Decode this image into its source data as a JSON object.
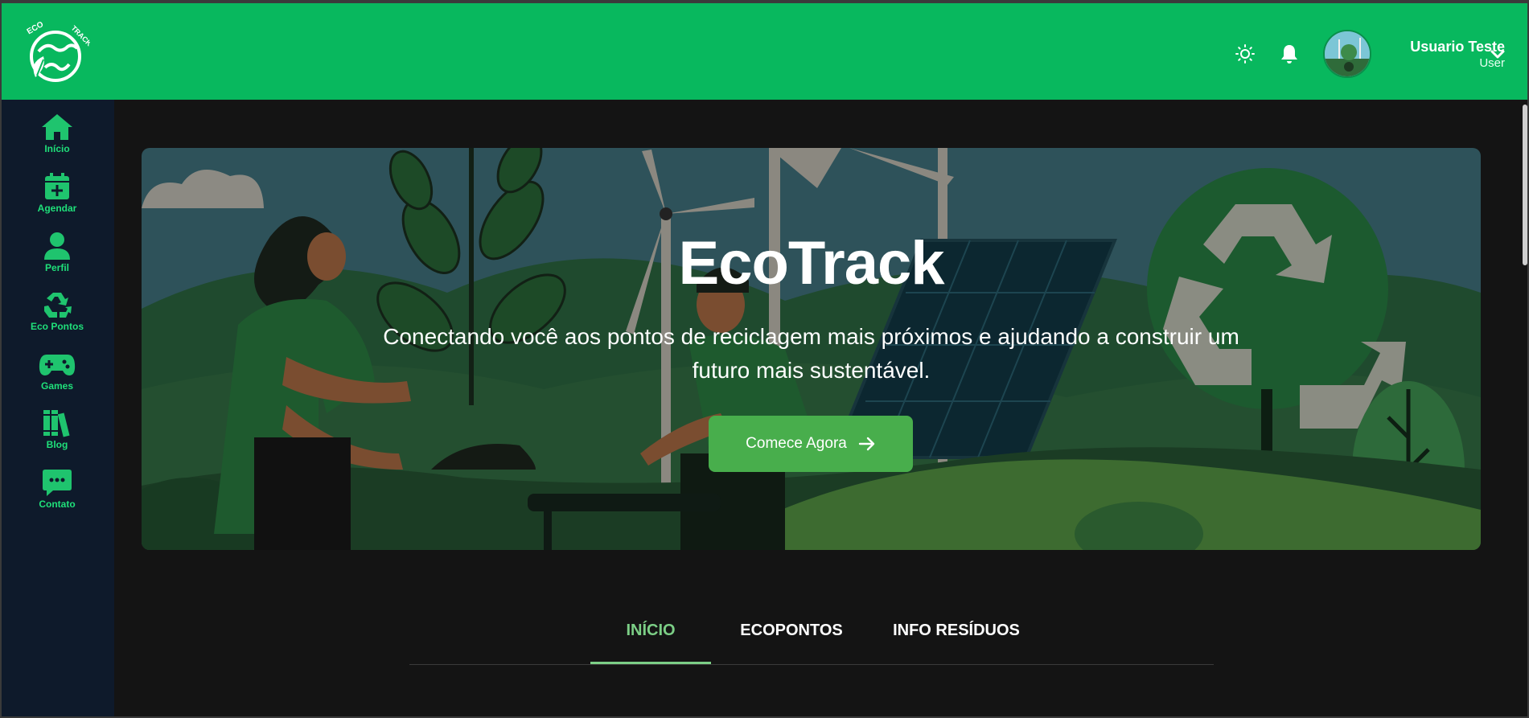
{
  "header": {
    "logo_text_top": "ECO",
    "logo_text_right": "TRACK",
    "user": {
      "name": "Usuario Teste",
      "role": "User"
    },
    "icons": [
      "theme-toggle-sun-icon",
      "bell-icon",
      "chevron-down-icon"
    ],
    "brand_color": "#08b85e"
  },
  "sidebar": {
    "items": [
      {
        "label": "Início",
        "icon": "home-icon"
      },
      {
        "label": "Agendar",
        "icon": "calendar-plus-icon"
      },
      {
        "label": "Perfil",
        "icon": "user-icon"
      },
      {
        "label": "Eco Pontos",
        "icon": "recycle-icon"
      },
      {
        "label": "Games",
        "icon": "gamepad-icon"
      },
      {
        "label": "Blog",
        "icon": "books-icon"
      },
      {
        "label": "Contato",
        "icon": "chat-icon"
      }
    ],
    "accent_color": "#1fe07a"
  },
  "hero": {
    "title": "EcoTrack",
    "subtitle": "Conectando você aos pontos de reciclagem mais próximos e ajudando a construir um futuro mais sustentável.",
    "cta_label": "Comece Agora",
    "cta_color": "#48ae4c"
  },
  "tabs": {
    "items": [
      {
        "label": "INÍCIO",
        "active": true
      },
      {
        "label": "ECOPONTOS",
        "active": false
      },
      {
        "label": "INFO RESÍDUOS",
        "active": false
      }
    ],
    "active_color": "#7ccf86"
  }
}
